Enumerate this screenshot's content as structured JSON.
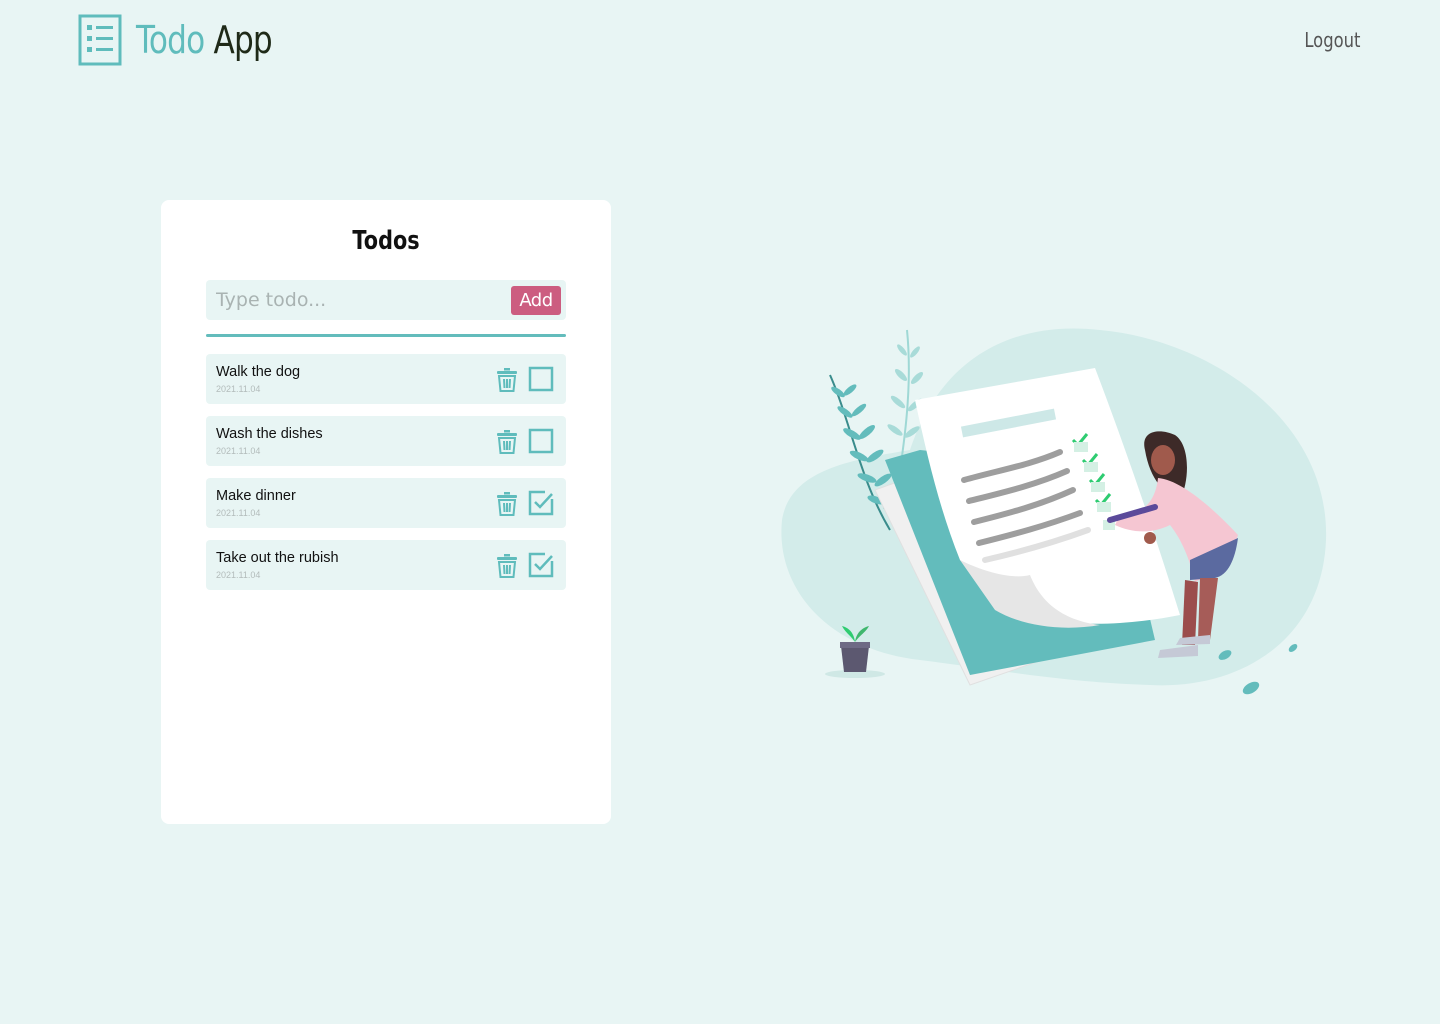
{
  "header": {
    "brand_part1": "Todo",
    "brand_part2": "App",
    "logout_label": "Logout"
  },
  "card": {
    "title": "Todos",
    "input_placeholder": "Type todo...",
    "add_label": "Add"
  },
  "todos": [
    {
      "text": "Walk the dog",
      "date": "2021.11.04",
      "done": false
    },
    {
      "text": "Wash the dishes",
      "date": "2021.11.04",
      "done": false
    },
    {
      "text": "Make dinner",
      "date": "2021.11.04",
      "done": true
    },
    {
      "text": "Take out the rubish",
      "date": "2021.11.04",
      "done": true
    }
  ],
  "colors": {
    "background": "#e8f5f4",
    "accent": "#5fbcbc",
    "add_button": "#cc5d80",
    "card": "#ffffff"
  }
}
